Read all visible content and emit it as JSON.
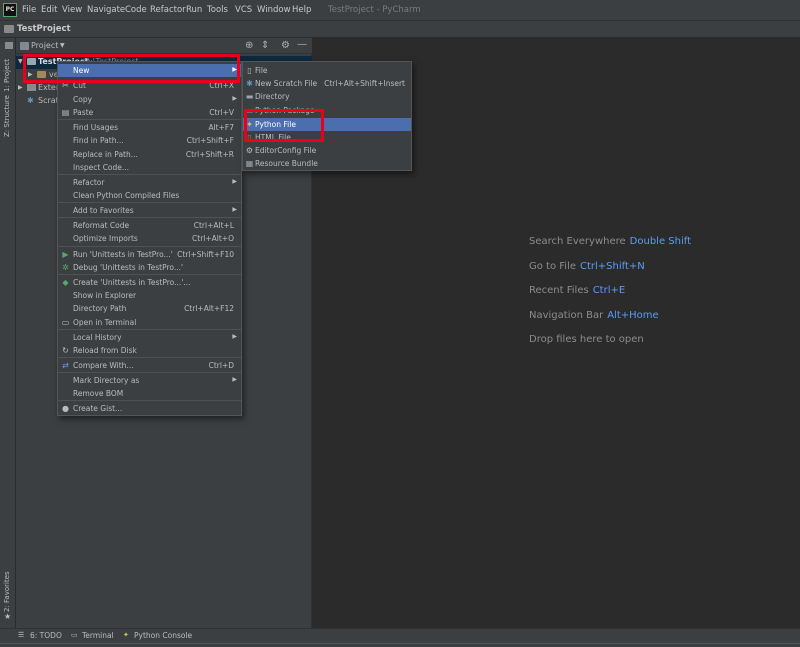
{
  "menubar": {
    "items": [
      "File",
      "Edit",
      "View",
      "Navigate",
      "Code",
      "Refactor",
      "Run",
      "Tools",
      "VCS",
      "Window",
      "Help"
    ],
    "window_title": "TestProject - PyCharm",
    "logo_text": "PC"
  },
  "navbar": {
    "project_name": "TestProject"
  },
  "left_strip": {
    "project_tab": "1: Project",
    "structure_tab": "Z: Structure",
    "favorites_tab": "2: Favorites"
  },
  "project_panel": {
    "title": "Project",
    "tree": {
      "root_name": "TestProject",
      "root_path": "D:\\TestProject",
      "venv_label": "ve",
      "external_label": "Extern",
      "scratches_label": "Scratc"
    }
  },
  "context_menu": {
    "items": [
      {
        "label": "New",
        "shortcut": "",
        "submenu": true
      },
      {
        "label": "Cut",
        "shortcut": "Ctrl+X"
      },
      {
        "label": "Copy",
        "shortcut": "",
        "submenu": true
      },
      {
        "label": "Paste",
        "shortcut": "Ctrl+V"
      },
      {
        "label": "Find Usages",
        "shortcut": "Alt+F7"
      },
      {
        "label": "Find in Path...",
        "shortcut": "Ctrl+Shift+F"
      },
      {
        "label": "Replace in Path...",
        "shortcut": "Ctrl+Shift+R"
      },
      {
        "label": "Inspect Code...",
        "shortcut": ""
      },
      {
        "label": "Refactor",
        "shortcut": "",
        "submenu": true
      },
      {
        "label": "Clean Python Compiled Files",
        "shortcut": ""
      },
      {
        "label": "Add to Favorites",
        "shortcut": "",
        "submenu": true
      },
      {
        "label": "Reformat Code",
        "shortcut": "Ctrl+Alt+L"
      },
      {
        "label": "Optimize Imports",
        "shortcut": "Ctrl+Alt+O"
      },
      {
        "label": "Run 'Unittests in TestPro...'",
        "shortcut": "Ctrl+Shift+F10"
      },
      {
        "label": "Debug 'Unittests in TestPro...'",
        "shortcut": ""
      },
      {
        "label": "Create 'Unittests in TestPro...'...",
        "shortcut": ""
      },
      {
        "label": "Show in Explorer",
        "shortcut": ""
      },
      {
        "label": "Directory Path",
        "shortcut": "Ctrl+Alt+F12"
      },
      {
        "label": "Open in Terminal",
        "shortcut": ""
      },
      {
        "label": "Local History",
        "shortcut": "",
        "submenu": true
      },
      {
        "label": "Reload from Disk",
        "shortcut": ""
      },
      {
        "label": "Compare With...",
        "shortcut": "Ctrl+D"
      },
      {
        "label": "Mark Directory as",
        "shortcut": "",
        "submenu": true
      },
      {
        "label": "Remove BOM",
        "shortcut": ""
      },
      {
        "label": "Create Gist...",
        "shortcut": ""
      }
    ]
  },
  "new_submenu": {
    "items": [
      {
        "label": "File",
        "shortcut": ""
      },
      {
        "label": "New Scratch File",
        "shortcut": "Ctrl+Alt+Shift+Insert"
      },
      {
        "label": "Directory",
        "shortcut": ""
      },
      {
        "label": "Python Package",
        "shortcut": ""
      },
      {
        "label": "Python File",
        "shortcut": ""
      },
      {
        "label": "HTML File",
        "shortcut": ""
      },
      {
        "label": "EditorConfig File",
        "shortcut": ""
      },
      {
        "label": "Resource Bundle",
        "shortcut": ""
      }
    ]
  },
  "editor_hints": [
    {
      "text": "Search Everywhere",
      "key": "Double Shift"
    },
    {
      "text": "Go to File",
      "key": "Ctrl+Shift+N"
    },
    {
      "text": "Recent Files",
      "key": "Ctrl+E"
    },
    {
      "text": "Navigation Bar",
      "key": "Alt+Home"
    },
    {
      "text": "Drop files here to open",
      "key": ""
    }
  ],
  "bottom_tabs": [
    "6: TODO",
    "Terminal",
    "Python Console"
  ],
  "colors": {
    "selection": "#4b6eaf",
    "highlight_box": "#e8001c",
    "hint_key": "#589df6"
  }
}
